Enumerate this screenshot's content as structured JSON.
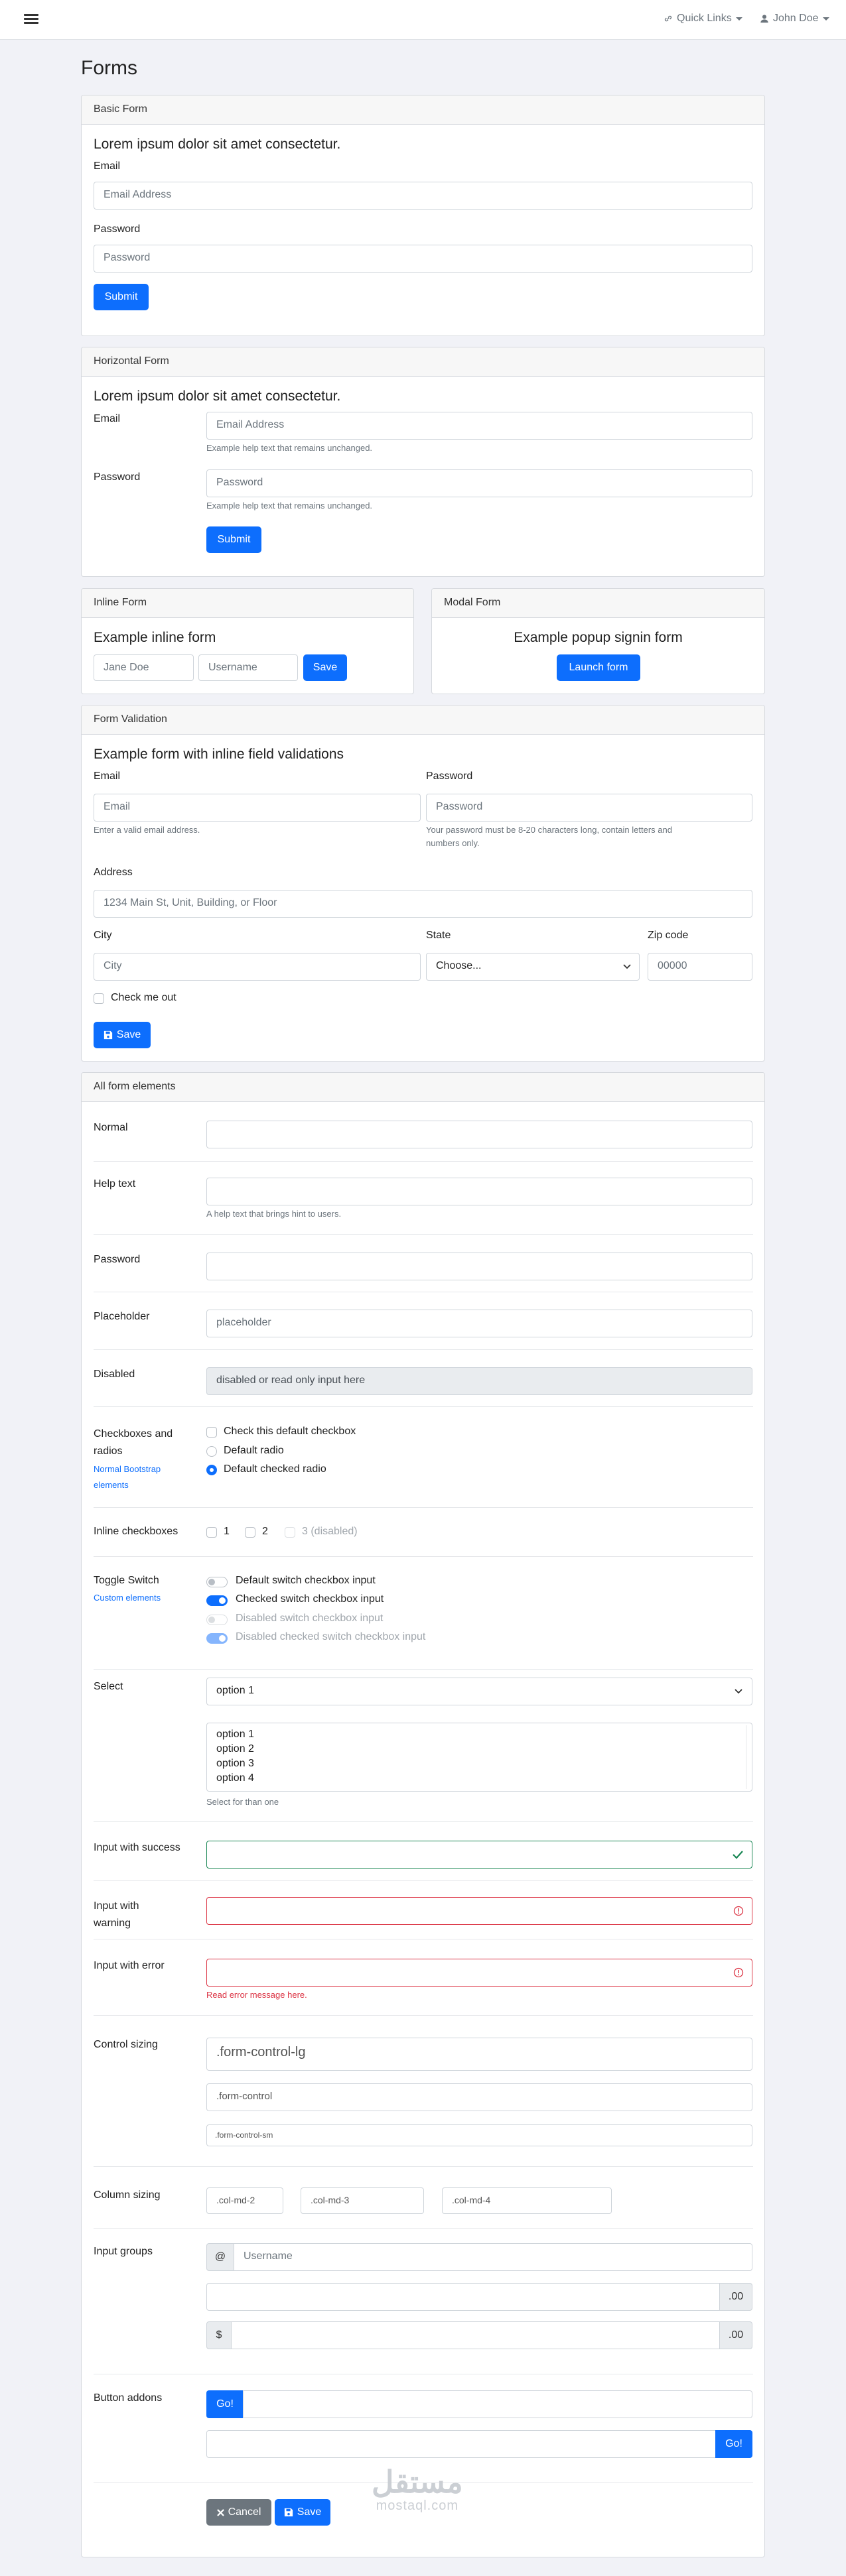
{
  "topbar": {
    "quick_links": "Quick Links",
    "user": "John Doe"
  },
  "page_title": "Forms",
  "basic": {
    "header": "Basic Form",
    "lead": "Lorem ipsum dolor sit amet consectetur.",
    "email_label": "Email",
    "email_ph": "Email Address",
    "password_label": "Password",
    "password_ph": "Password",
    "submit": "Submit"
  },
  "horizontal": {
    "header": "Horizontal Form",
    "lead": "Lorem ipsum dolor sit amet consectetur.",
    "email_label": "Email",
    "email_ph": "Email Address",
    "email_help": "Example help text that remains unchanged.",
    "password_label": "Password",
    "password_ph": "Password",
    "password_help": "Example help text that remains unchanged.",
    "submit": "Submit"
  },
  "inline": {
    "header": "Inline Form",
    "lead": "Example inline form",
    "name_ph": "Jane Doe",
    "user_ph": "Username",
    "save": "Save"
  },
  "modal": {
    "header": "Modal Form",
    "lead": "Example popup signin form",
    "launch": "Launch form"
  },
  "validation": {
    "header": "Form Validation",
    "lead": "Example form with inline field validations",
    "email_label": "Email",
    "email_ph": "Email",
    "email_help": "Enter a valid email address.",
    "password_label": "Password",
    "password_ph": "Password",
    "password_help_1": "Your password must be 8-20 characters long, contain letters and",
    "password_help_2": "numbers only.",
    "address_label": "Address",
    "address_ph": "1234 Main St, Unit, Building, or Floor",
    "city_label": "City",
    "city_ph": "City",
    "state_label": "State",
    "state_value": "Choose...",
    "zip_label": "Zip code",
    "zip_ph": "00000",
    "check_label": "Check me out",
    "save": "Save"
  },
  "all": {
    "header": "All form elements",
    "normal_label": "Normal",
    "helptext_label": "Help text",
    "helptext_help": "A help text that brings hint to users.",
    "password_label": "Password",
    "placeholder_label": "Placeholder",
    "placeholder_ph": "placeholder",
    "disabled_label": "Disabled",
    "disabled_value": "disabled or read only input here",
    "checkradio_label_1": "Checkboxes and",
    "checkradio_label_2": "radios",
    "checkradio_link_1": "Normal Bootstrap",
    "checkradio_link_2": "elements",
    "check_default": "Check this default checkbox",
    "radio_default": "Default radio",
    "radio_checked": "Default checked radio",
    "inline_label": "Inline checkboxes",
    "inline_opts": [
      "1",
      "2",
      "3 (disabled)"
    ],
    "toggle_label": "Toggle Switch",
    "toggle_link": "Custom elements",
    "switches": [
      "Default switch checkbox input",
      "Checked switch checkbox input",
      "Disabled switch checkbox input",
      "Disabled checked switch checkbox input"
    ],
    "select_label": "Select",
    "select_value": "option 1",
    "multi_options": [
      "option 1",
      "option 2",
      "option 3",
      "option 4"
    ],
    "multi_help": "Select for than one",
    "success_label": "Input with success",
    "warning_label_1": "Input with",
    "warning_label_2": "warning",
    "error_label": "Input with error",
    "error_help": "Read error message here.",
    "sizing_label": "Control sizing",
    "size_lg": ".form-control-lg",
    "size_md": ".form-control",
    "size_sm": ".form-control-sm",
    "colsizing_label": "Column sizing",
    "cols": [
      ".col-md-2",
      ".col-md-3",
      ".col-md-4"
    ],
    "groups_label": "Input groups",
    "group_at": "@",
    "group_user_ph": "Username",
    "group_cents": ".00",
    "group_dollar": "$",
    "addons_label": "Button addons",
    "go": "Go!",
    "cancel": "Cancel",
    "save": "Save"
  },
  "watermark": {
    "arabic": "مستقل",
    "latin": "mostaql.com"
  }
}
